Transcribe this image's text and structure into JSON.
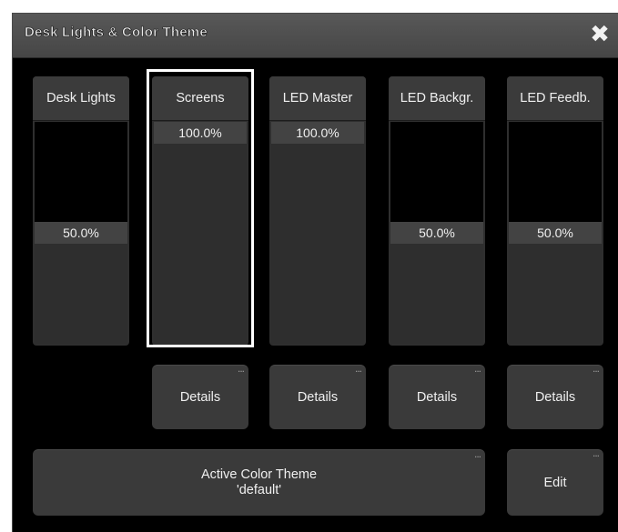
{
  "window": {
    "title": "Desk Lights & Color Theme"
  },
  "faders": [
    {
      "label": "Desk Lights",
      "value": "50.0%",
      "level": 0.5
    },
    {
      "label": "Screens",
      "value": "100.0%",
      "level": 1.0,
      "selected": true
    },
    {
      "label": "LED Master",
      "value": "100.0%",
      "level": 1.0
    },
    {
      "label": "LED Backgr.",
      "value": "50.0%",
      "level": 0.5
    },
    {
      "label": "LED Feedb.",
      "value": "50.0%",
      "level": 0.5
    }
  ],
  "details_buttons": [
    {
      "label": "Details"
    },
    {
      "label": "Details"
    },
    {
      "label": "Details"
    },
    {
      "label": "Details"
    }
  ],
  "color_theme": {
    "line1": "Active Color Theme",
    "line2": "'default'",
    "edit_label": "Edit",
    "more_indicator": "..."
  },
  "colors": {
    "background": "#000000",
    "titlebar": "#505050",
    "fader_body": "#2f2f2f",
    "value_bar": "#434343",
    "selection": "#ffffff"
  }
}
